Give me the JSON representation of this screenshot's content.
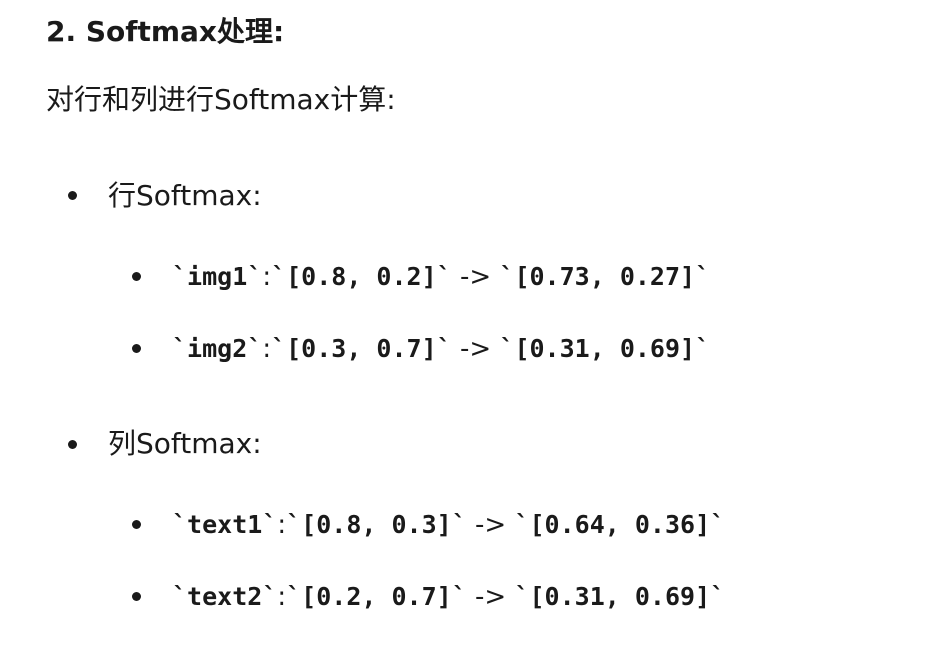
{
  "section": {
    "heading": "2. Softmax处理:",
    "intro": "对行和列进行Softmax计算:"
  },
  "row_softmax": {
    "label": "行Softmax:",
    "items": [
      {
        "name": "`img1`",
        "sep": ":",
        "input": "`[0.8, 0.2]`",
        "arrow": " -> ",
        "output": "`[0.73, 0.27]`"
      },
      {
        "name": "`img2`",
        "sep": ":",
        "input": "`[0.3, 0.7]`",
        "arrow": " -> ",
        "output": "`[0.31, 0.69]`"
      }
    ]
  },
  "col_softmax": {
    "label": "列Softmax:",
    "items": [
      {
        "name": "`text1`",
        "sep": ":",
        "input": "`[0.8, 0.3]`",
        "arrow": " -> ",
        "output": "`[0.64, 0.36]`"
      },
      {
        "name": "`text2`",
        "sep": ":",
        "input": "`[0.2, 0.7]`",
        "arrow": " -> ",
        "output": "`[0.31, 0.69]`"
      }
    ]
  }
}
